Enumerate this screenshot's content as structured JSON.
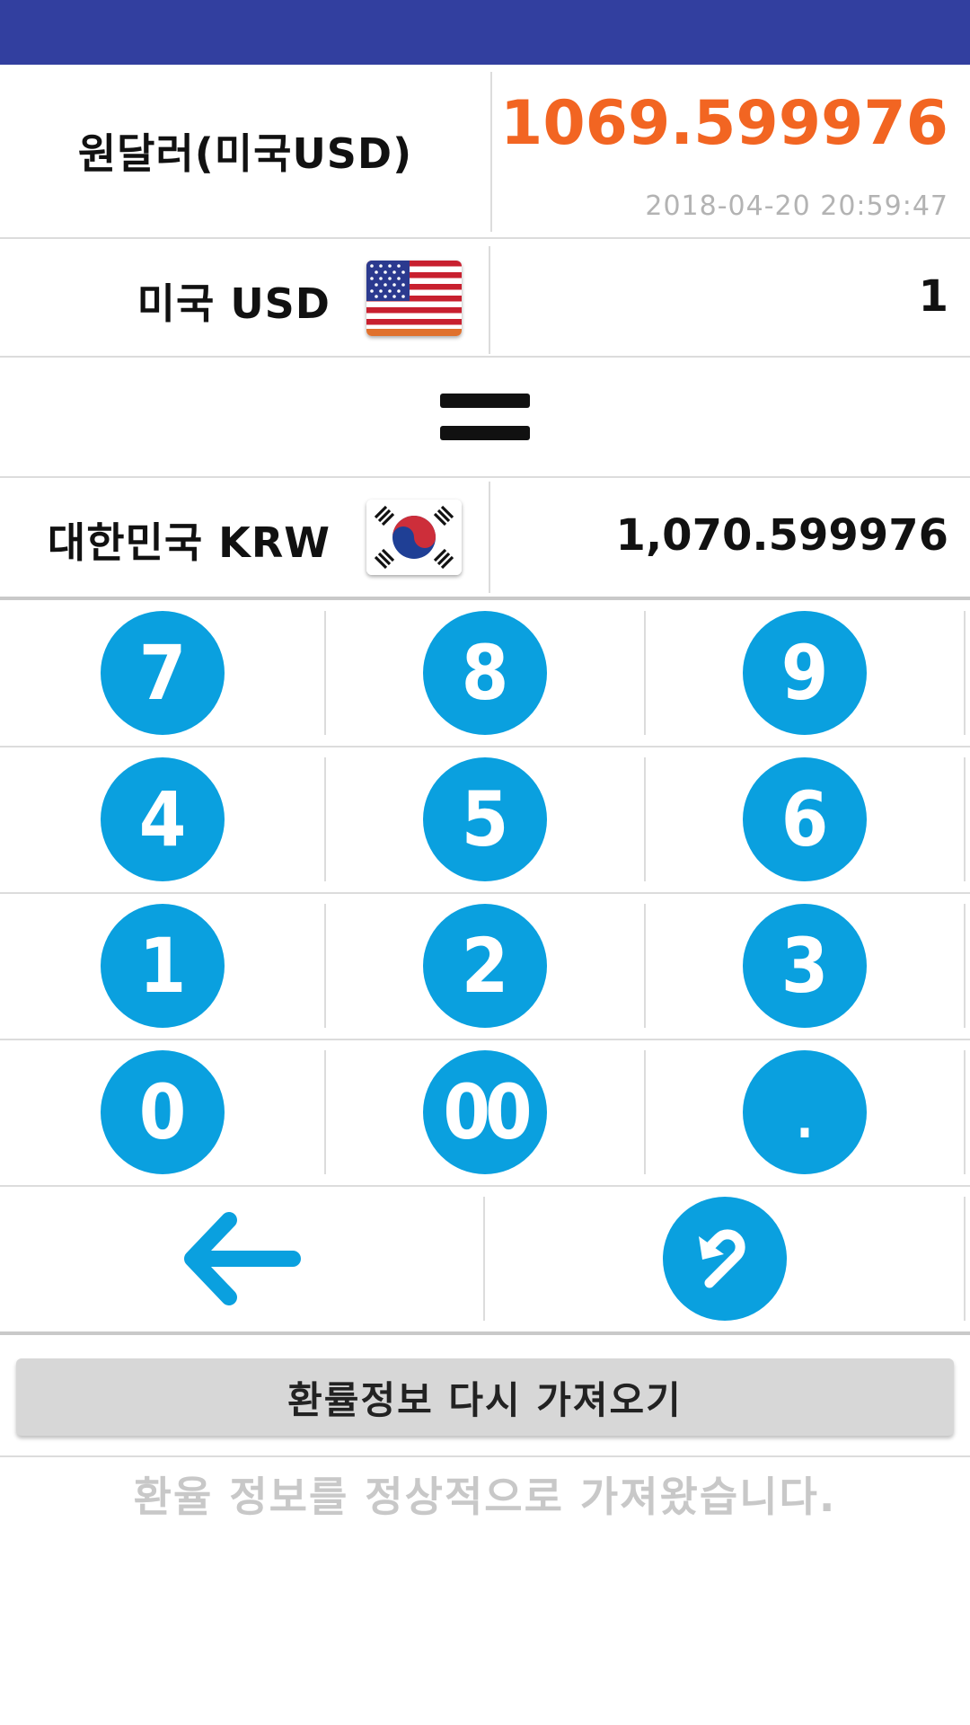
{
  "rate": {
    "title": "원달러(미국USD)",
    "value": "1069.599976",
    "timestamp": "2018-04-20 20:59:47"
  },
  "from_currency": {
    "label": "미국 USD",
    "amount": "1",
    "flag_icon": "us-flag-icon"
  },
  "to_currency": {
    "label": "대한민국 KRW",
    "amount": "1,070.599976",
    "flag_icon": "kr-flag-icon"
  },
  "keypad": {
    "rows": [
      [
        "7",
        "8",
        "9"
      ],
      [
        "4",
        "5",
        "6"
      ],
      [
        "1",
        "2",
        "3"
      ],
      [
        "0",
        "00",
        "."
      ]
    ],
    "backspace_icon": "arrow-left-icon",
    "reset_icon": "undo-icon"
  },
  "refresh_button": {
    "label": "환률정보 다시 가져오기"
  },
  "status_message": "환율 정보를 정상적으로 가져왔습니다.",
  "colors": {
    "status_bar": "#323f9f",
    "rate_value": "#f26522",
    "key_blue": "#0aa0df",
    "timestamp_gray": "#b3b3b3"
  }
}
